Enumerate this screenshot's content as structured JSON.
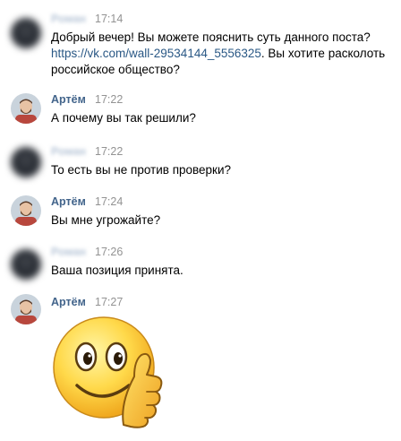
{
  "messages": [
    {
      "author": "Роман",
      "author_hidden": true,
      "time": "17:14",
      "text_before": "Добрый вечер! Вы можете пояснить суть данного поста?",
      "link": "https://vk.com/wall-29534144_5556325",
      "text_after": ". Вы хотите расколоть российское общество?"
    },
    {
      "author": "Артём",
      "author_hidden": false,
      "time": "17:22",
      "text": "А почему вы так решили?"
    },
    {
      "author": "Роман",
      "author_hidden": true,
      "time": "17:22",
      "text": "То есть вы не против проверки?"
    },
    {
      "author": "Артём",
      "author_hidden": false,
      "time": "17:24",
      "text": "Вы мне угрожайте?"
    },
    {
      "author": "Роман",
      "author_hidden": true,
      "time": "17:26",
      "text": "Ваша позиция принята."
    },
    {
      "author": "Артём",
      "author_hidden": false,
      "time": "17:27",
      "sticker": "thumbs-up-smiley-sticker"
    }
  ],
  "colors": {
    "author_name": "#42648b",
    "link": "#2a5885",
    "timestamp": "#939393",
    "text": "#000000",
    "background": "#ffffff"
  }
}
